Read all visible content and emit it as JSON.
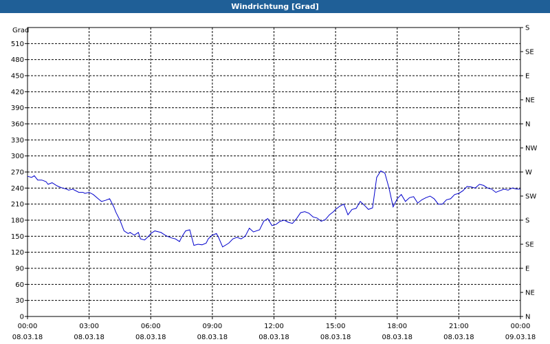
{
  "window": {
    "title": "Windrichtung [Grad]"
  },
  "chart_data": {
    "type": "line",
    "title": "Windrichtung [Grad]",
    "ylabel": "Grad",
    "ylim": [
      0,
      540
    ],
    "yticks": [
      0,
      30,
      60,
      90,
      120,
      150,
      180,
      210,
      240,
      270,
      300,
      330,
      360,
      390,
      420,
      450,
      480,
      510
    ],
    "y2ticks": [
      {
        "value": 0,
        "label": "N"
      },
      {
        "value": 45,
        "label": "NE"
      },
      {
        "value": 90,
        "label": "E"
      },
      {
        "value": 135,
        "label": "SE"
      },
      {
        "value": 180,
        "label": "S"
      },
      {
        "value": 225,
        "label": "SW"
      },
      {
        "value": 270,
        "label": "W"
      },
      {
        "value": 315,
        "label": "NW"
      },
      {
        "value": 360,
        "label": "N"
      },
      {
        "value": 405,
        "label": "NE"
      },
      {
        "value": 450,
        "label": "E"
      },
      {
        "value": 495,
        "label": "SE"
      },
      {
        "value": 540,
        "label": "S"
      }
    ],
    "xlim": [
      0,
      24
    ],
    "xticks": [
      {
        "value": 0,
        "time": "00:00",
        "date": "08.03.18"
      },
      {
        "value": 3,
        "time": "03:00",
        "date": "08.03.18"
      },
      {
        "value": 6,
        "time": "06:00",
        "date": "08.03.18"
      },
      {
        "value": 9,
        "time": "09:00",
        "date": "08.03.18"
      },
      {
        "value": 12,
        "time": "12:00",
        "date": "08.03.18"
      },
      {
        "value": 15,
        "time": "15:00",
        "date": "08.03.18"
      },
      {
        "value": 18,
        "time": "18:00",
        "date": "08.03.18"
      },
      {
        "value": 21,
        "time": "21:00",
        "date": "08.03.18"
      },
      {
        "value": 24,
        "time": "00:00",
        "date": "09.03.18"
      }
    ],
    "grid": true,
    "series_color": "#0000cc",
    "series": [
      {
        "x": [
          0,
          0.2,
          0.33,
          0.5,
          0.7,
          0.9,
          1.0,
          1.2,
          1.4,
          1.5,
          1.7,
          1.9,
          2.0,
          2.2,
          2.5,
          2.7,
          2.8,
          3.0,
          3.2,
          3.5,
          3.6,
          3.8,
          4.0,
          4.2,
          4.3,
          4.5,
          4.7,
          4.9,
          5.0,
          5.2,
          5.4,
          5.5,
          5.7,
          5.9,
          6.0,
          6.2,
          6.5,
          6.7,
          6.8,
          7.0,
          7.2,
          7.4,
          7.5,
          7.7,
          7.9,
          8.1,
          8.3,
          8.5,
          8.7,
          8.8,
          9.0,
          9.2,
          9.3,
          9.5,
          9.8,
          10.0,
          10.2,
          10.4,
          10.6,
          10.8,
          11.0,
          11.3,
          11.5,
          11.7,
          11.9,
          12.1,
          12.3,
          12.5,
          12.7,
          12.9,
          13.1,
          13.3,
          13.5,
          13.7,
          13.9,
          14.1,
          14.3,
          14.5,
          14.7,
          14.9,
          15.0,
          15.2,
          15.4,
          15.6,
          15.8,
          16.0,
          16.2,
          16.4,
          16.6,
          16.8,
          17.0,
          17.2,
          17.4,
          17.6,
          17.8,
          18.0,
          18.2,
          18.4,
          18.6,
          18.8,
          19.0,
          19.2,
          19.4,
          19.6,
          19.8,
          20.0,
          20.2,
          20.4,
          20.6,
          20.8,
          21.0,
          21.2,
          21.4,
          21.6,
          21.8,
          22.0,
          22.2,
          22.4,
          22.6,
          22.8,
          23.0,
          23.2,
          23.4,
          23.6,
          23.8,
          24.0
        ],
        "y": [
          262,
          260,
          263,
          255,
          255,
          252,
          247,
          250,
          245,
          243,
          240,
          238,
          236,
          238,
          232,
          232,
          230,
          232,
          228,
          218,
          215,
          217,
          220,
          205,
          195,
          180,
          160,
          155,
          157,
          152,
          157,
          145,
          143,
          150,
          155,
          160,
          157,
          152,
          150,
          147,
          145,
          140,
          148,
          160,
          162,
          133,
          135,
          134,
          137,
          145,
          152,
          155,
          148,
          130,
          137,
          145,
          148,
          145,
          150,
          165,
          158,
          162,
          178,
          183,
          170,
          172,
          178,
          180,
          176,
          174,
          183,
          194,
          196,
          193,
          186,
          184,
          178,
          181,
          190,
          196,
          200,
          206,
          210,
          190,
          200,
          202,
          215,
          208,
          200,
          203,
          260,
          272,
          268,
          240,
          205,
          220,
          228,
          215,
          222,
          224,
          212,
          218,
          222,
          225,
          220,
          210,
          210,
          218,
          220,
          228,
          230,
          235,
          243,
          242,
          240,
          247,
          245,
          240,
          238,
          232,
          235,
          238,
          236,
          240,
          238,
          238
        ]
      }
    ]
  }
}
